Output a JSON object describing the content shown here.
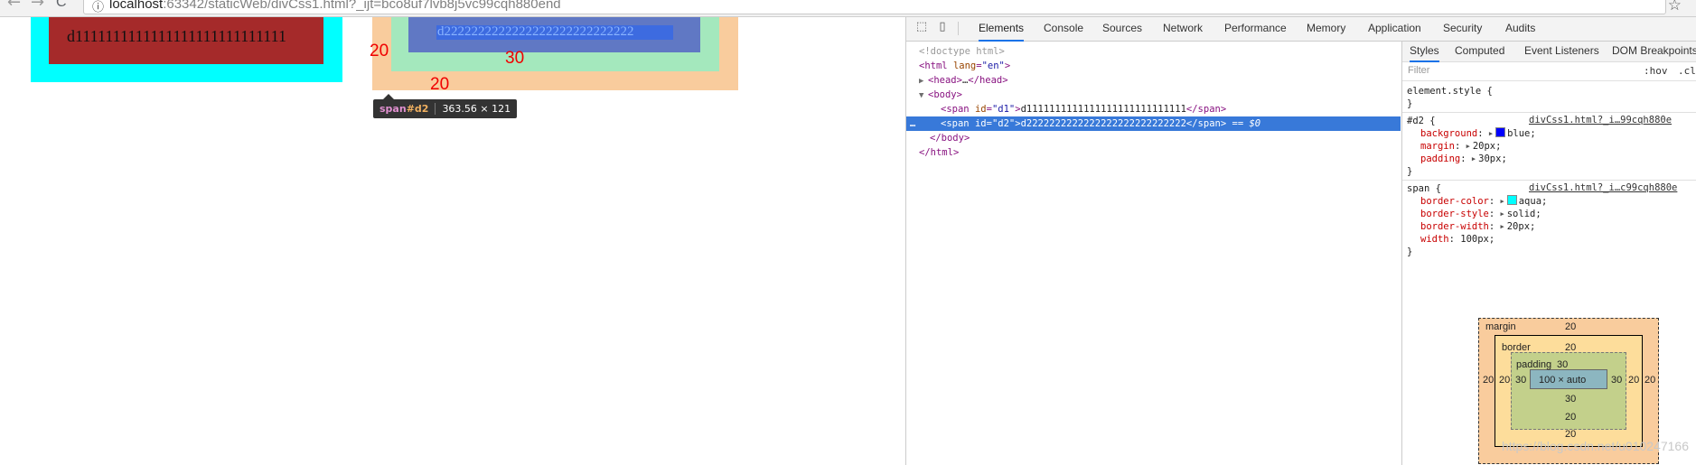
{
  "browser": {
    "back_icon": "←",
    "forward_icon": "→",
    "reload_icon": "C",
    "url_host": "localhost",
    "url_rest": ":63342/staticWeb/divCss1.html?_ijt=bco8uf7lvb8j5vc99cqh880end",
    "star_icon": "☆"
  },
  "page": {
    "d1_text": "d1111111111111111111111111111",
    "d2_text": "d2222222222222222222222222222",
    "colors": {
      "d1_border": "#00ffff",
      "d1_background": "#a52a2a",
      "d2_margin": "#f9cc9d",
      "d2_border": "#a4e8bd",
      "d2_padding": "#6078c4",
      "label_red": "#f00000"
    },
    "labels": {
      "margin_left": "20",
      "padding": "30",
      "margin_bottom": "20"
    },
    "tooltip": {
      "tag": "span",
      "id": "#d2",
      "size": "363.56 × 121"
    }
  },
  "devtools": {
    "tabs": [
      "Elements",
      "Console",
      "Sources",
      "Network",
      "Performance",
      "Memory",
      "Application",
      "Security",
      "Audits"
    ],
    "active_tab": "Elements",
    "dom": {
      "doctype": "<!doctype html>",
      "html_open": "html",
      "html_attr_name": "lang",
      "html_attr_value": "\"en\"",
      "head": "head",
      "head_ellipsis": "…",
      "body_open": "body",
      "span1_id": "\"d1\"",
      "span1_text": "d1111111111111111111111111111",
      "span2_id": "\"d2\"",
      "span2_text": "d2222222222222222222222222222",
      "selected_suffix": "== $0",
      "row_menu": "…",
      "body_close": "body",
      "html_close": "html",
      "span_tag": "span",
      "id_attr": "id"
    },
    "styles": {
      "tabs": [
        "Styles",
        "Computed",
        "Event Listeners",
        "DOM Breakpoints"
      ],
      "active_tab": "Styles",
      "filter_placeholder": "Filter",
      "hov": ":hov",
      "cls": ".cls",
      "element_style_selector": "element.style {",
      "open_brace": "{",
      "close_brace": "}",
      "rule_d2": {
        "selector": "#d2",
        "source": "divCss1.html?_i…99cqh880e",
        "decls": [
          {
            "prop": "background",
            "val": "blue",
            "swatch": "#0000ff"
          },
          {
            "prop": "margin",
            "val": "20px"
          },
          {
            "prop": "padding",
            "val": "30px"
          }
        ]
      },
      "rule_span": {
        "selector": "span",
        "source": "divCss1.html?_i…c99cqh880e",
        "decls": [
          {
            "prop": "border-color",
            "val": "aqua",
            "swatch": "#00ffff"
          },
          {
            "prop": "border-style",
            "val": "solid"
          },
          {
            "prop": "border-width",
            "val": "20px"
          },
          {
            "prop": "width",
            "val": "100px"
          }
        ]
      }
    },
    "box_model": {
      "margin_label": "margin",
      "border_label": "border",
      "padding_label": "padding",
      "margin": {
        "top": "20",
        "right": "20",
        "bottom": "20",
        "left": "20"
      },
      "border": {
        "top": "20",
        "right": "20",
        "bottom": "20",
        "left": "20"
      },
      "padding": {
        "top": "30",
        "right": "30",
        "bottom": "30",
        "left": "30"
      },
      "content": "100 × auto"
    }
  },
  "watermark": "https://blog.csdn.net/u010247166"
}
